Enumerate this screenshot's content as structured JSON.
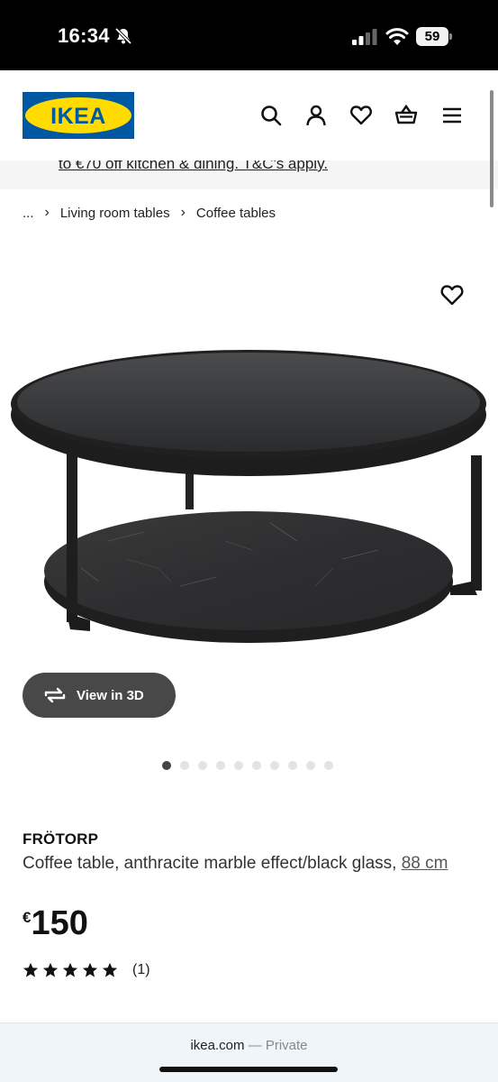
{
  "status_bar": {
    "time": "16:34",
    "battery": "59",
    "icons": [
      "bell-slash-icon",
      "signal-icon",
      "wifi-icon",
      "battery-icon"
    ]
  },
  "header": {
    "logo_text": "IKEA",
    "brand_colors": {
      "blue": "#0058a3",
      "yellow": "#ffdb00"
    },
    "icons": [
      "search-icon",
      "user-icon",
      "heart-icon",
      "basket-icon",
      "menu-icon"
    ]
  },
  "promo": {
    "text": "to €70 off kitchen & dining. T&C's apply."
  },
  "breadcrumb": {
    "ellipsis": "...",
    "items": [
      "Living room tables",
      "Coffee tables"
    ]
  },
  "gallery": {
    "view3d_label": "View in 3D",
    "total_images": 10,
    "active_index": 0
  },
  "product": {
    "name": "FRÖTORP",
    "description": "Coffee table, anthracite marble effect/black glass,",
    "size": "88 cm",
    "currency": "€",
    "price": "150",
    "rating": 5,
    "review_count": "(1)"
  },
  "browser": {
    "domain": "ikea.com",
    "separator": " — ",
    "mode": "Private"
  }
}
